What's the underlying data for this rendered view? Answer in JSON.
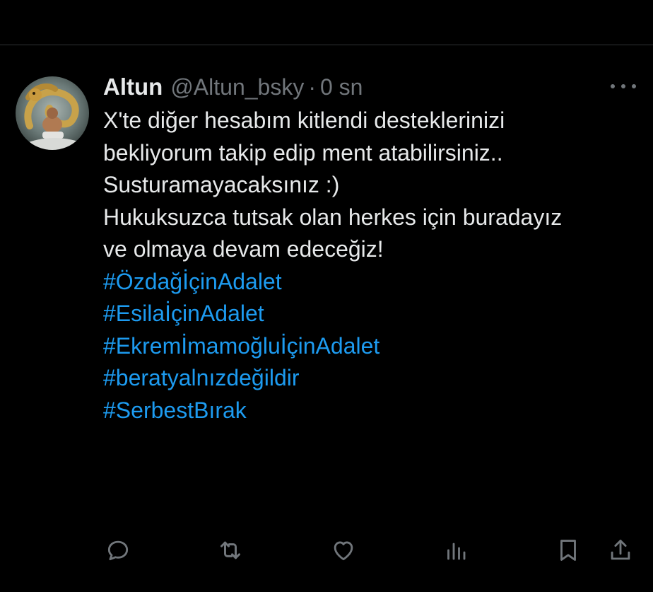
{
  "tweet": {
    "display_name": "Altun",
    "handle": "@Altun_bsky",
    "separator": "·",
    "time": "0 sn",
    "text_lines": [
      "X'te diğer hesabım kitlendi desteklerinizi",
      "bekliyorum takip edip ment atabilirsiniz..",
      "Susturamayacaksınız :)",
      "Hukuksuzca tutsak olan herkes için buradayız",
      "ve olmaya devam edeceğiz!"
    ],
    "hashtags": [
      "#ÖzdağİçinAdalet",
      "#Esilaİçin​Adalet",
      "#EkremİmamoğluİçinAdalet",
      "#beratyalnızdeğildir",
      "#SerbestBırak"
    ]
  },
  "actions": {
    "reply_icon": "reply-icon",
    "retweet_icon": "retweet-icon",
    "like_icon": "heart-icon",
    "views_icon": "views-icon",
    "bookmark_icon": "bookmark-icon",
    "share_icon": "share-icon"
  },
  "colors": {
    "background": "#000000",
    "text": "#e7e9ea",
    "secondary": "#71767b",
    "link": "#1d9bf0",
    "divider": "#2f3336"
  }
}
